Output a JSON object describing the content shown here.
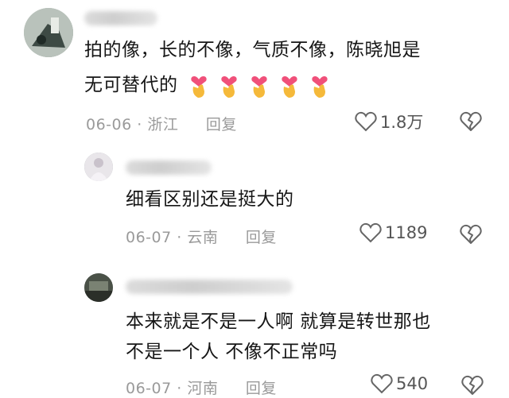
{
  "comments": [
    {
      "text_lines": [
        "拍的像，长的不像，气质不像，陈晓旭是",
        "无可替代的"
      ],
      "emojis": [
        "finger-heart",
        "finger-heart",
        "finger-heart",
        "finger-heart",
        "finger-heart"
      ],
      "date": "06-06",
      "location": "浙江",
      "reply_label": "回复",
      "likes": "1.8万"
    },
    {
      "text_lines": [
        "细看区别还是挺大的"
      ],
      "date": "06-07",
      "location": "云南",
      "reply_label": "回复",
      "likes": "1189"
    },
    {
      "text_lines": [
        "本来就是不是一人啊 就算是转世那也",
        "不是一个人 不像不正常吗"
      ],
      "date": "06-07",
      "location": "河南",
      "reply_label": "回复",
      "likes": "540"
    }
  ],
  "meta_separator": " · ",
  "colors": {
    "meta": "#9a9a9a",
    "text": "#161616",
    "emoji_heart": "#f0507a",
    "emoji_hand": "#f5b93a"
  }
}
